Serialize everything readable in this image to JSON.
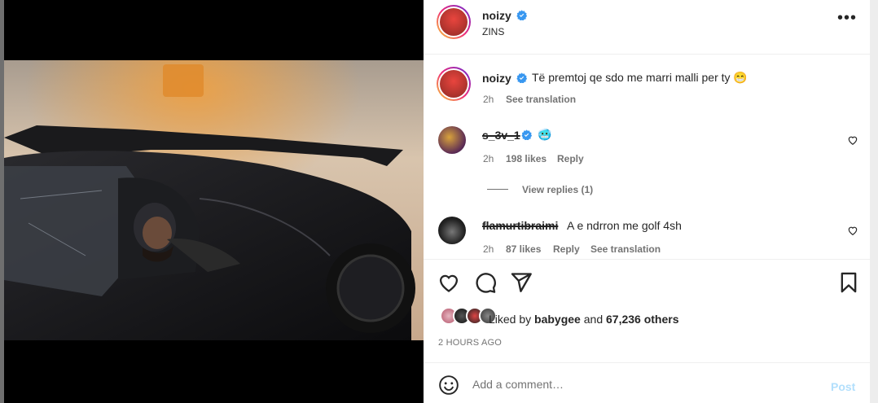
{
  "post": {
    "author": "noizy",
    "location": "ZINS",
    "verified": true
  },
  "caption": {
    "username": "noizy",
    "text": "Të premtoj qe sdo me marri malli per ty 😁",
    "time": "2h",
    "see_translation": "See translation"
  },
  "comments": [
    {
      "username": "s_3v_1",
      "text": "🥶",
      "time": "2h",
      "likes": "198 likes",
      "reply": "Reply",
      "view_replies": "View replies (1)"
    },
    {
      "username": "flamurtibraimi",
      "text": "A e ndrron me golf 4sh",
      "time": "2h",
      "likes": "87 likes",
      "reply": "Reply",
      "see_translation": "See translation"
    }
  ],
  "likes": {
    "prefix": "Liked by ",
    "first_user": "babygee",
    "connector": " and ",
    "others": "67,236 others"
  },
  "timestamp": "2 HOURS AGO",
  "add_comment": {
    "placeholder": "Add a comment…",
    "post_label": "Post"
  },
  "colors": {
    "verified_blue": "#3897f0",
    "post_button_disabled": "#b2dffc",
    "secondary_text": "#737373"
  }
}
